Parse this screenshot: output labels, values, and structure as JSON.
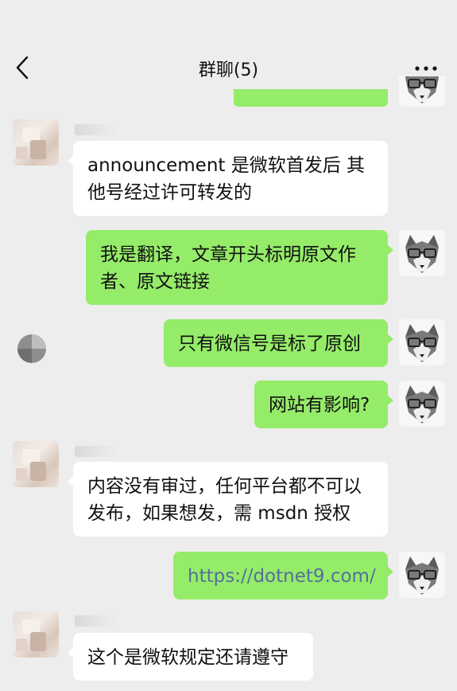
{
  "header": {
    "title": "群聊(5)",
    "back_icon": "chevron-left-icon",
    "more_icon": "more-dots-icon"
  },
  "messages": [
    {
      "side": "in",
      "text": "announcement 是微软首发后 其他号经过许可转发的"
    },
    {
      "side": "out",
      "text": "我是翻译，文章开头标明原文作者、原文链接"
    },
    {
      "side": "out",
      "text": "只有微信号是标了原创"
    },
    {
      "side": "out",
      "text": "网站有影响?"
    },
    {
      "side": "in",
      "text": "内容没有审过，任何平台都不可以发布，如果想发，需 msdn 授权"
    },
    {
      "side": "out",
      "text": "https://dotnet9.com/",
      "is_link": true
    },
    {
      "side": "in",
      "text": "这个是微软规定还请遵守"
    }
  ],
  "colors": {
    "background": "#ededed",
    "bubble_out": "#95ec69",
    "bubble_in": "#ffffff",
    "link": "#566f9b"
  }
}
